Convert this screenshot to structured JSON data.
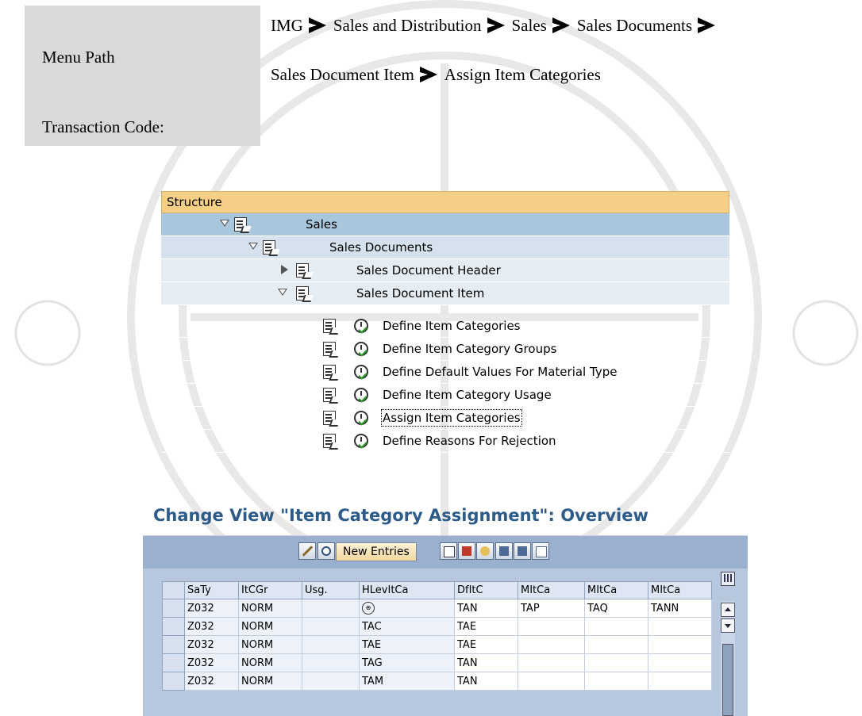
{
  "menu": {
    "menu_path_label": "Menu Path",
    "transaction_code_label": "Transaction Code:",
    "path_line1": [
      "IMG",
      "Sales and Distribution",
      "Sales",
      "Sales Documents"
    ],
    "path_line2": [
      "Sales Document Item",
      "Assign Item Categories"
    ]
  },
  "structure": {
    "header": "Structure",
    "rows": [
      {
        "label": "Sales",
        "expand": "expanded"
      },
      {
        "label": "Sales Documents",
        "expand": "expanded"
      },
      {
        "label": "Sales Document Header",
        "expand": "collapsed"
      },
      {
        "label": "Sales Document Item",
        "expand": "expanded"
      }
    ],
    "activities": [
      "Define Item Categories",
      "Define Item Category Groups",
      "Define Default Values For Material Type",
      "Define Item Category Usage",
      "Assign Item Categories",
      "Define Reasons For Rejection"
    ],
    "focused_activity": "Assign Item Categories",
    "colors": {
      "header": "#f5cf86",
      "level1": "#a9c7dc",
      "level2": "#d5e2ed",
      "level3": "#e5ecf2"
    }
  },
  "overview": {
    "title": "Change View \"Item Category Assignment\": Overview",
    "toolbar": {
      "change_icon": "display-change-icon",
      "details_icon": "details-icon",
      "new_entries_label": "New Entries",
      "icons": [
        "copy-icon",
        "delete-icon",
        "undo-icon",
        "select-all-icon",
        "select-block-icon",
        "deselect-all-icon"
      ]
    },
    "columns": [
      "SaTy",
      "ItCGr",
      "Usg.",
      "HLevItCa",
      "DfItC",
      "MItCa",
      "MItCa",
      "MItCa"
    ],
    "rows": [
      [
        "Z032",
        "NORM",
        "",
        "",
        "TAN",
        "TAP",
        "TAQ",
        "TANN"
      ],
      [
        "Z032",
        "NORM",
        "",
        "TAC",
        "TAE",
        "",
        "",
        ""
      ],
      [
        "Z032",
        "NORM",
        "",
        "TAE",
        "TAE",
        "",
        "",
        ""
      ],
      [
        "Z032",
        "NORM",
        "",
        "TAG",
        "TAN",
        "",
        "",
        ""
      ],
      [
        "Z032",
        "NORM",
        "",
        "TAM",
        "TAN",
        "",
        "",
        ""
      ]
    ]
  }
}
